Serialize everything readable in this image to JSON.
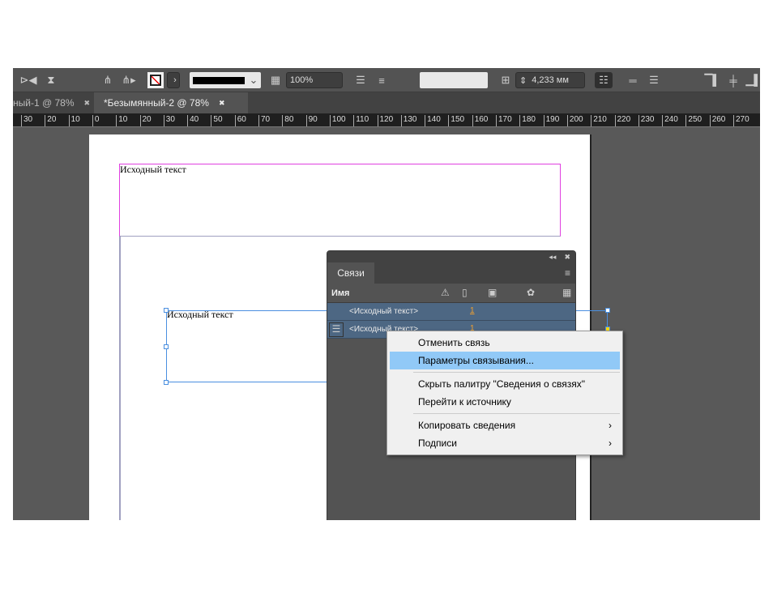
{
  "toolbar": {
    "zoom": "100%",
    "offset": "4,233 мм"
  },
  "tabs": [
    {
      "label": "ный-1 @ 78%",
      "close": "✖"
    },
    {
      "label": "*Безымянный-2 @ 78%",
      "close": "✖"
    }
  ],
  "ruler": [
    "30",
    "20",
    "10",
    "0",
    "10",
    "20",
    "30",
    "40",
    "50",
    "60",
    "70",
    "80",
    "90",
    "100",
    "110",
    "120",
    "130",
    "140",
    "150",
    "160",
    "170",
    "180",
    "190",
    "200",
    "210",
    "220",
    "230",
    "240",
    "250",
    "260",
    "270"
  ],
  "page": {
    "text1": "Исходный текст",
    "text2": "Исходный текст"
  },
  "panel": {
    "tab": "Связи",
    "column": "Имя",
    "rows": [
      {
        "name": "<Исходный текст>",
        "page": "1"
      },
      {
        "name": "<Исходный текст>",
        "page": "1"
      }
    ]
  },
  "menu": {
    "items": [
      "Отменить связь",
      "Параметры связывания...",
      "Скрыть палитру \"Сведения о связях\"",
      "Перейти к источнику",
      "Копировать сведения",
      "Подписи"
    ],
    "submenu_arrow": "›"
  },
  "colors": {
    "accent": "#91c9f7",
    "row": "#4d6783",
    "frame": "#e040e0"
  }
}
